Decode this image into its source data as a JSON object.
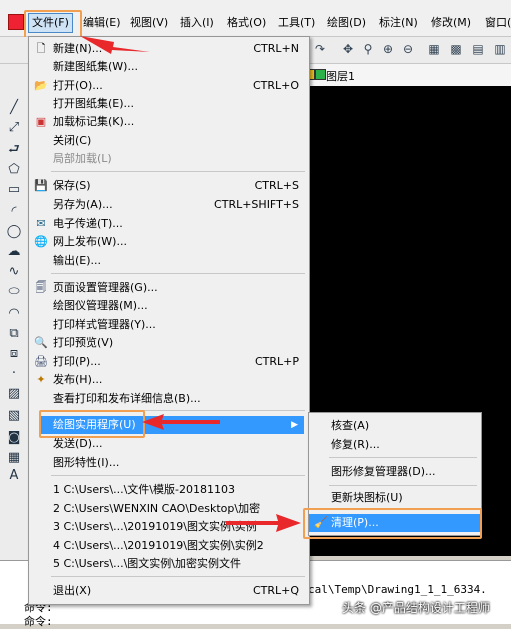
{
  "menubar": {
    "items": [
      "文件(F)",
      "编辑(E)",
      "视图(V)",
      "插入(I)",
      "格式(O)",
      "工具(T)",
      "绘图(D)",
      "标注(N)",
      "修改(M)",
      "窗口("
    ]
  },
  "layer": {
    "name": "图层1"
  },
  "file_menu": {
    "items": [
      {
        "label": "新建(N)...",
        "shortcut": "CTRL+N",
        "icon": "new-doc-icon"
      },
      {
        "label": "新建图纸集(W)...",
        "shortcut": "",
        "icon": ""
      },
      {
        "label": "打开(O)...",
        "shortcut": "CTRL+O",
        "icon": "open-folder-icon"
      },
      {
        "label": "打开图纸集(E)...",
        "shortcut": "",
        "icon": ""
      },
      {
        "label": "加载标记集(K)...",
        "shortcut": "",
        "icon": "markup-icon"
      },
      {
        "label": "关闭(C)",
        "shortcut": "",
        "icon": ""
      },
      {
        "label": "局部加载(L)",
        "shortcut": "",
        "icon": "",
        "disabled": true
      },
      {
        "label": "保存(S)",
        "shortcut": "CTRL+S",
        "icon": "save-icon"
      },
      {
        "label": "另存为(A)...",
        "shortcut": "CTRL+SHIFT+S",
        "icon": ""
      },
      {
        "label": "电子传递(T)...",
        "shortcut": "",
        "icon": "etransmit-icon"
      },
      {
        "label": "网上发布(W)...",
        "shortcut": "",
        "icon": "publish-web-icon"
      },
      {
        "label": "输出(E)...",
        "shortcut": "",
        "icon": ""
      },
      {
        "label": "页面设置管理器(G)...",
        "shortcut": "",
        "icon": "page-setup-icon"
      },
      {
        "label": "绘图仪管理器(M)...",
        "shortcut": "",
        "icon": ""
      },
      {
        "label": "打印样式管理器(Y)...",
        "shortcut": "",
        "icon": ""
      },
      {
        "label": "打印预览(V)",
        "shortcut": "",
        "icon": "print-preview-icon"
      },
      {
        "label": "打印(P)...",
        "shortcut": "CTRL+P",
        "icon": "print-icon"
      },
      {
        "label": "发布(H)...",
        "shortcut": "",
        "icon": "publish-icon"
      },
      {
        "label": "查看打印和发布详细信息(B)...",
        "shortcut": "",
        "icon": ""
      },
      {
        "label": "绘图实用程序(U)",
        "shortcut": "",
        "icon": ""
      },
      {
        "label": "发送(D)...",
        "shortcut": "",
        "icon": ""
      },
      {
        "label": "图形特性(I)...",
        "shortcut": "",
        "icon": ""
      },
      {
        "label": "1 C:\\Users\\...\\文件\\模版-20181103",
        "shortcut": "",
        "icon": ""
      },
      {
        "label": "2 C:\\Users\\WENXIN CAO\\Desktop\\加密",
        "shortcut": "",
        "icon": ""
      },
      {
        "label": "3 C:\\Users\\...\\20191019\\图文实例\\实例",
        "shortcut": "",
        "icon": ""
      },
      {
        "label": "4 C:\\Users\\...\\20191019\\图文实例\\实例2",
        "shortcut": "",
        "icon": ""
      },
      {
        "label": "5 C:\\Users\\...\\图文实例\\加密实例文件",
        "shortcut": "",
        "icon": ""
      },
      {
        "label": "退出(X)",
        "shortcut": "CTRL+Q",
        "icon": ""
      }
    ]
  },
  "sub_menu": {
    "items": [
      {
        "label": "核查(A)"
      },
      {
        "label": "修复(R)..."
      },
      {
        "label": "图形修复管理器(D)..."
      },
      {
        "label": "更新块图标(U)"
      },
      {
        "label": "清理(P)..."
      }
    ]
  },
  "command": {
    "line1": "cal\\Temp\\Drawing1_1_1_6334.",
    "line2": "命令:",
    "line3": "命令:"
  },
  "watermark": "头条 @产品结构设计工程师",
  "colors": {
    "highlight": "#3399ff",
    "annotation_box": "#f0a050",
    "annotation_arrow": "#e8282b"
  }
}
